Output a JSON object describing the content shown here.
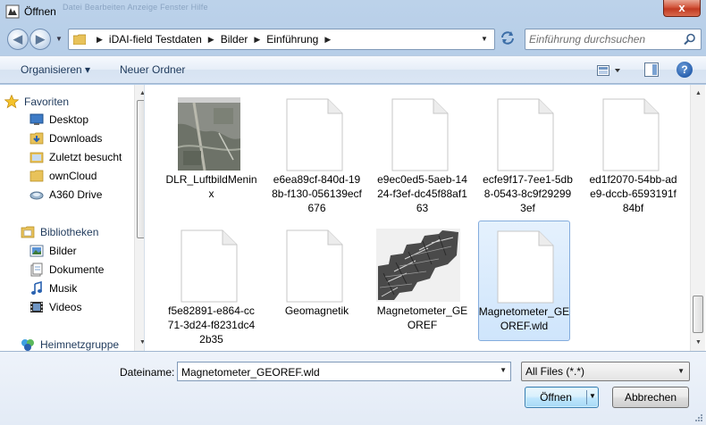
{
  "window": {
    "title": "Öffnen",
    "ghost_menu": "Datei   Bearbeiten   Anzeige   Fenster   Hilfe",
    "close_label": "x"
  },
  "nav": {
    "back_glyph": "◀",
    "forward_glyph": "▶",
    "breadcrumbs": [
      "iDAI-field Testdaten",
      "Bilder",
      "Einführung"
    ],
    "search_placeholder": "Einführung durchsuchen"
  },
  "toolbar": {
    "organize_label": "Organisieren ▾",
    "new_folder_label": "Neuer Ordner",
    "help_label": "?"
  },
  "sidebar": {
    "items": [
      {
        "label": "Favoriten",
        "icon": "star-icon"
      },
      {
        "label": "Desktop",
        "icon": "desktop-icon"
      },
      {
        "label": "Downloads",
        "icon": "downloads-icon"
      },
      {
        "label": "Zuletzt besucht",
        "icon": "recent-places-icon"
      },
      {
        "label": "ownCloud",
        "icon": "folder-icon"
      },
      {
        "label": "A360 Drive",
        "icon": "drive-icon"
      },
      {
        "label": "Bibliotheken",
        "icon": "libraries-icon"
      },
      {
        "label": "Bilder",
        "icon": "pictures-icon"
      },
      {
        "label": "Dokumente",
        "icon": "documents-icon"
      },
      {
        "label": "Musik",
        "icon": "music-icon"
      },
      {
        "label": "Videos",
        "icon": "videos-icon"
      },
      {
        "label": "Heimnetzgruppe",
        "icon": "homegroup-icon"
      }
    ]
  },
  "files": [
    {
      "name": "DLR_LuftbildMenin​x",
      "kind": "aerial-image"
    },
    {
      "name": "e6ea89cf-840d-198b-f130-056139ecf676",
      "kind": "document"
    },
    {
      "name": "e9ec0ed5-5aeb-1424-f3ef-dc45f88af163",
      "kind": "document"
    },
    {
      "name": "ecfe9f17-7ee1-5db8-0543-8c9f292993ef",
      "kind": "document"
    },
    {
      "name": "ed1f2070-54bb-ade9-dccb-6593191f84bf",
      "kind": "document"
    },
    {
      "name": "f5e82891-e864-cc71-3d24-f8231dc42b35",
      "kind": "document"
    },
    {
      "name": "Geomagnetik",
      "kind": "document"
    },
    {
      "name": "Magnetometer_GEOREF",
      "kind": "magnetometer-image"
    },
    {
      "name": "Magnetometer_GEOREF.wld",
      "kind": "document",
      "selected": true
    }
  ],
  "bottom": {
    "filename_label": "Dateiname:",
    "filename_value": "Magnetometer_GEOREF.wld",
    "filetype_value": "All Files (*.*)",
    "open_label": "Öffnen",
    "cancel_label": "Abbrechen"
  }
}
